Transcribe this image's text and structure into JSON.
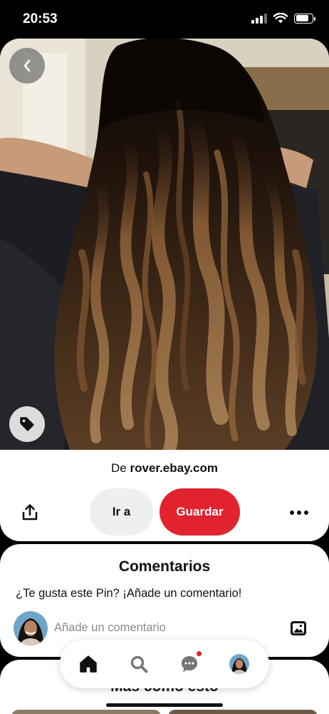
{
  "status_bar": {
    "time": "20:53",
    "icons": [
      "signal-icon",
      "wifi-icon",
      "battery-icon"
    ]
  },
  "pin": {
    "image_alt": "long wavy dark hair with caramel balayage",
    "source_prefix": "De",
    "source_domain": "rover.ebay.com",
    "icons": {
      "back": "chevron-left-icon",
      "tag": "tag-icon"
    }
  },
  "actions": {
    "share_icon": "share-icon",
    "visit_label": "Ir a",
    "save_label": "Guardar",
    "more_icon": "ellipsis-icon"
  },
  "comments": {
    "title": "Comentarios",
    "prompt": "¿Te gusta este Pin? ¡Añade un comentario!",
    "input_placeholder": "Añade un comentario",
    "photo_icon": "image-icon"
  },
  "more_like_this": {
    "title": "Más como esto"
  },
  "bottom_nav": {
    "items": [
      "home-icon",
      "search-icon",
      "chat-icon",
      "profile-avatar"
    ],
    "active": "home-icon",
    "notification_color": "#e0232e"
  },
  "colors": {
    "save_button": "#e0232e",
    "visit_button": "#efefef"
  }
}
